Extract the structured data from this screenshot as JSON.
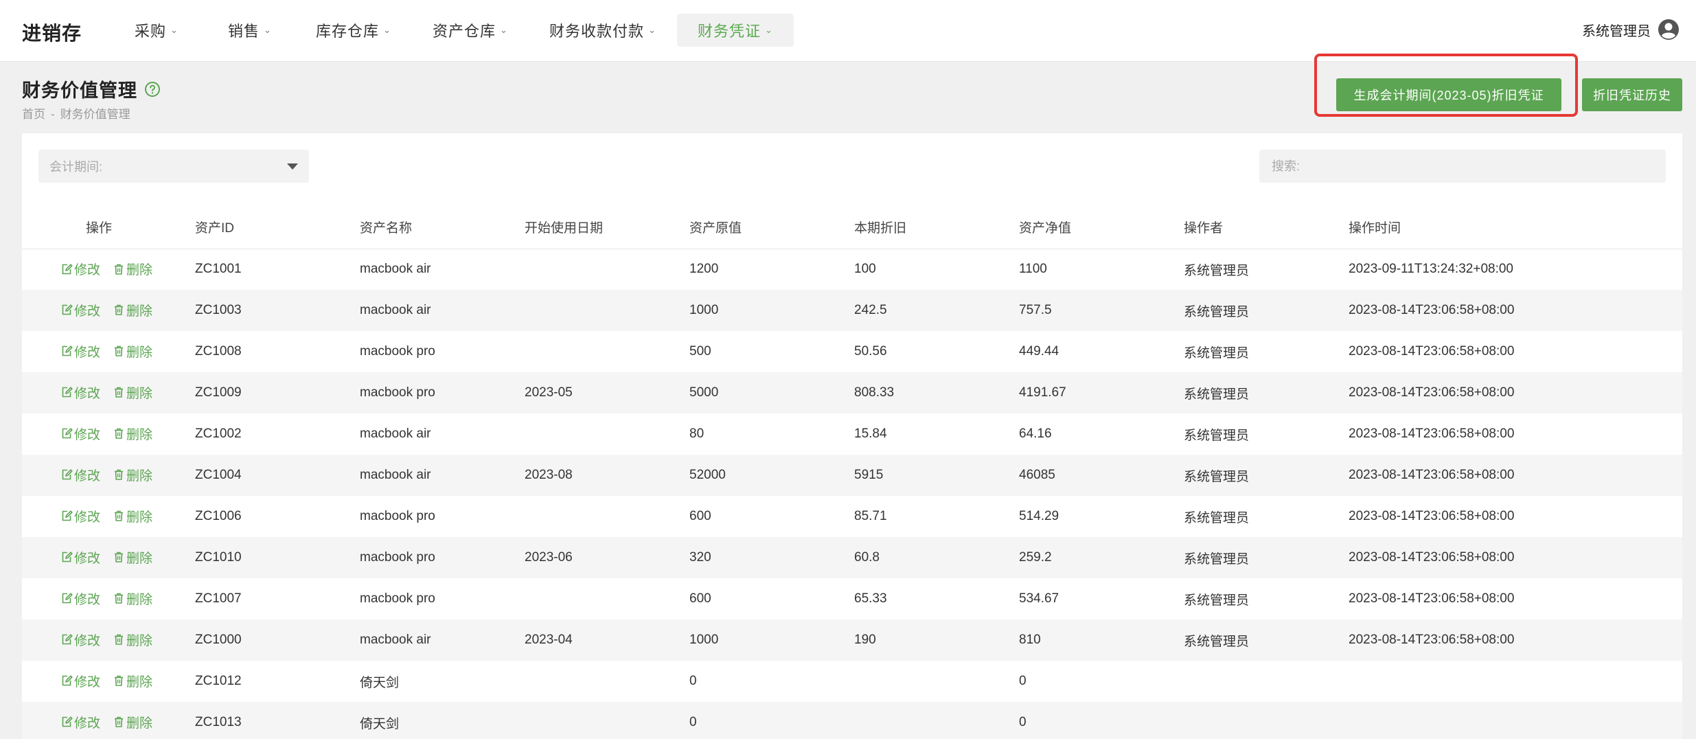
{
  "nav": {
    "brand": "进销存",
    "items": [
      {
        "label": "采购",
        "active": false
      },
      {
        "label": "销售",
        "active": false
      },
      {
        "label": "库存仓库",
        "active": false
      },
      {
        "label": "资产仓库",
        "active": false
      },
      {
        "label": "财务收款付款",
        "active": false
      },
      {
        "label": "财务凭证",
        "active": true
      }
    ],
    "user": "系统管理员"
  },
  "page": {
    "title": "财务价值管理",
    "breadcrumb": [
      "首页",
      "财务价值管理"
    ],
    "breadcrumb_sep": "-",
    "generate_button": "生成会计期间(2023-05)折旧凭证",
    "history_button": "折旧凭证历史"
  },
  "filters": {
    "period_placeholder": "会计期间:",
    "search_placeholder": "搜索:"
  },
  "table": {
    "columns": [
      "操作",
      "资产ID",
      "资产名称",
      "开始使用日期",
      "资产原值",
      "本期折旧",
      "资产净值",
      "操作者",
      "操作时间"
    ],
    "edit_label": "修改",
    "delete_label": "删除",
    "rows": [
      {
        "id": "ZC1001",
        "name": "macbook air",
        "start": "",
        "original": "1200",
        "depreciation": "100",
        "net": "1100",
        "operator": "系统管理员",
        "time": "2023-09-11T13:24:32+08:00"
      },
      {
        "id": "ZC1003",
        "name": "macbook air",
        "start": "",
        "original": "1000",
        "depreciation": "242.5",
        "net": "757.5",
        "operator": "系统管理员",
        "time": "2023-08-14T23:06:58+08:00"
      },
      {
        "id": "ZC1008",
        "name": "macbook pro",
        "start": "",
        "original": "500",
        "depreciation": "50.56",
        "net": "449.44",
        "operator": "系统管理员",
        "time": "2023-08-14T23:06:58+08:00"
      },
      {
        "id": "ZC1009",
        "name": "macbook pro",
        "start": "2023-05",
        "original": "5000",
        "depreciation": "808.33",
        "net": "4191.67",
        "operator": "系统管理员",
        "time": "2023-08-14T23:06:58+08:00"
      },
      {
        "id": "ZC1002",
        "name": "macbook air",
        "start": "",
        "original": "80",
        "depreciation": "15.84",
        "net": "64.16",
        "operator": "系统管理员",
        "time": "2023-08-14T23:06:58+08:00"
      },
      {
        "id": "ZC1004",
        "name": "macbook air",
        "start": "2023-08",
        "original": "52000",
        "depreciation": "5915",
        "net": "46085",
        "operator": "系统管理员",
        "time": "2023-08-14T23:06:58+08:00"
      },
      {
        "id": "ZC1006",
        "name": "macbook pro",
        "start": "",
        "original": "600",
        "depreciation": "85.71",
        "net": "514.29",
        "operator": "系统管理员",
        "time": "2023-08-14T23:06:58+08:00"
      },
      {
        "id": "ZC1010",
        "name": "macbook pro",
        "start": "2023-06",
        "original": "320",
        "depreciation": "60.8",
        "net": "259.2",
        "operator": "系统管理员",
        "time": "2023-08-14T23:06:58+08:00"
      },
      {
        "id": "ZC1007",
        "name": "macbook pro",
        "start": "",
        "original": "600",
        "depreciation": "65.33",
        "net": "534.67",
        "operator": "系统管理员",
        "time": "2023-08-14T23:06:58+08:00"
      },
      {
        "id": "ZC1000",
        "name": "macbook air",
        "start": "2023-04",
        "original": "1000",
        "depreciation": "190",
        "net": "810",
        "operator": "系统管理员",
        "time": "2023-08-14T23:06:58+08:00"
      },
      {
        "id": "ZC1012",
        "name": "倚天剑",
        "start": "",
        "original": "0",
        "depreciation": "",
        "net": "0",
        "operator": "",
        "time": ""
      },
      {
        "id": "ZC1013",
        "name": "倚天剑",
        "start": "",
        "original": "0",
        "depreciation": "",
        "net": "0",
        "operator": "",
        "time": ""
      }
    ]
  },
  "colors": {
    "accent": "#5ca552",
    "highlight": "#e53935"
  }
}
